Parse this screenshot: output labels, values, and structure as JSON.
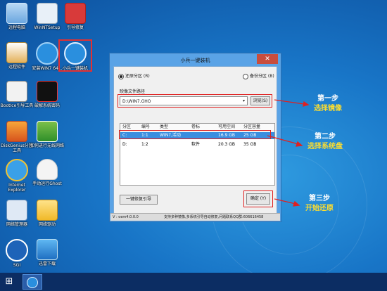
{
  "desktop": {
    "icons": [
      {
        "label": "远程电脑",
        "icon": "computer-icon"
      },
      {
        "label": "WinNTSetup",
        "icon": "setup-icon"
      },
      {
        "label": "引导修复",
        "icon": "toolbox-icon"
      },
      {
        "label": "远程软件",
        "icon": "remote-icon"
      },
      {
        "label": "安装WIN7 64...",
        "icon": "install-icon"
      },
      {
        "label": "小兵一键装机",
        "icon": "installer-icon"
      },
      {
        "label": "BootIce引导工具",
        "icon": "bootice-icon"
      },
      {
        "label": "破解系统密码",
        "icon": "password-icon"
      },
      {
        "label": "DiskGenius分区工具",
        "icon": "diskgenius-icon"
      },
      {
        "label": "如何进行无线网络",
        "icon": "wifi-help-icon"
      },
      {
        "label": "Internet Explorer",
        "icon": "ie-icon"
      },
      {
        "label": "手动运行Ghost",
        "icon": "ghost-icon"
      },
      {
        "label": "网络管理器",
        "icon": "network-icon"
      },
      {
        "label": "网络驱动",
        "icon": "folder-icon"
      },
      {
        "label": "SGI",
        "icon": "sgi-icon"
      },
      {
        "label": "迅雷下载",
        "icon": "thunder-icon"
      }
    ]
  },
  "window": {
    "title": "小兵一键装机",
    "close_glyph": "✕",
    "radio_restore": "还原分区 (R)",
    "radio_backup": "备份分区 (B)",
    "image_path_label": "映像文件路径",
    "image_path_value": "D:\\WIN7.GHO",
    "combo_arrow": "▾",
    "browse_button": "浏览(S)",
    "table": {
      "headers": [
        "分区",
        "编号",
        "类型",
        "卷标",
        "可用空间",
        "分区容量"
      ],
      "rows": [
        [
          "C:",
          "1:1",
          "WIN7,活动",
          "",
          "16.9 GB",
          "25 GB"
        ],
        [
          "D:",
          "1:2",
          "",
          "软件",
          "20.3 GB",
          "35 GB"
        ]
      ]
    },
    "repair_button": "一键修复引导",
    "ok_button": "确定 (Y)",
    "version": "V : oem4.0.0.0",
    "support_text": "支持多种镜像,多系统引导自动修复,问题联系QQ群:606616458"
  },
  "annotations": [
    {
      "line1": "第一步",
      "line2": "选择镜像"
    },
    {
      "line1": "第二步",
      "line2": "选择系统盘"
    },
    {
      "line1": "第三步",
      "line2": "开始还原"
    }
  ],
  "taskbar": {
    "start_glyph": "⊞"
  },
  "colors": {
    "desktop_bg": "#1875c7",
    "window_frame": "#5aa3e6",
    "selection": "#3a8ee0",
    "annotation_red": "#e02020",
    "annotation_yellow": "#ffde2e"
  }
}
